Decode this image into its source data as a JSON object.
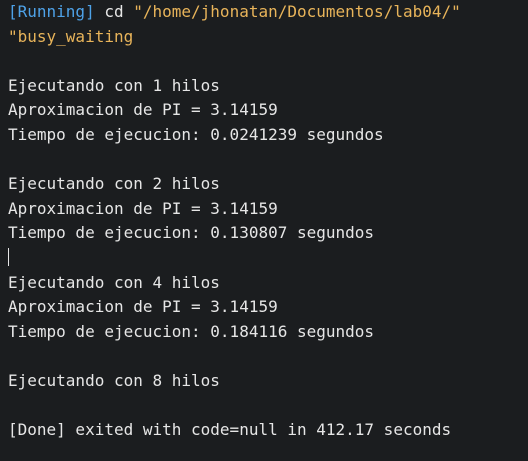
{
  "terminal": {
    "running_tag": "[Running]",
    "command_prefix": " cd ",
    "command_path_part1": "\"/home/jhonatan/Documentos/lab04/\"",
    "command_path_part2": "\"busy_waiting",
    "runs": [
      {
        "threads_line": "Ejecutando con 1 hilos",
        "pi_line": "Aproximacion de PI = 3.14159",
        "time_line": "Tiempo de ejecucion: 0.0241239 segundos"
      },
      {
        "threads_line": "Ejecutando con 2 hilos",
        "pi_line": "Aproximacion de PI = 3.14159",
        "time_line": "Tiempo de ejecucion: 0.130807 segundos"
      },
      {
        "threads_line": "Ejecutando con 4 hilos",
        "pi_line": "Aproximacion de PI = 3.14159",
        "time_line": "Tiempo de ejecucion: 0.184116 segundos"
      },
      {
        "threads_line": "Ejecutando con 8 hilos"
      }
    ],
    "done_line": "[Done] exited with code=null in 412.17 seconds"
  },
  "colors": {
    "background": "#1b1d1f",
    "text": "#e6e6e6",
    "running": "#4ea2e8",
    "path": "#e8b45a"
  }
}
